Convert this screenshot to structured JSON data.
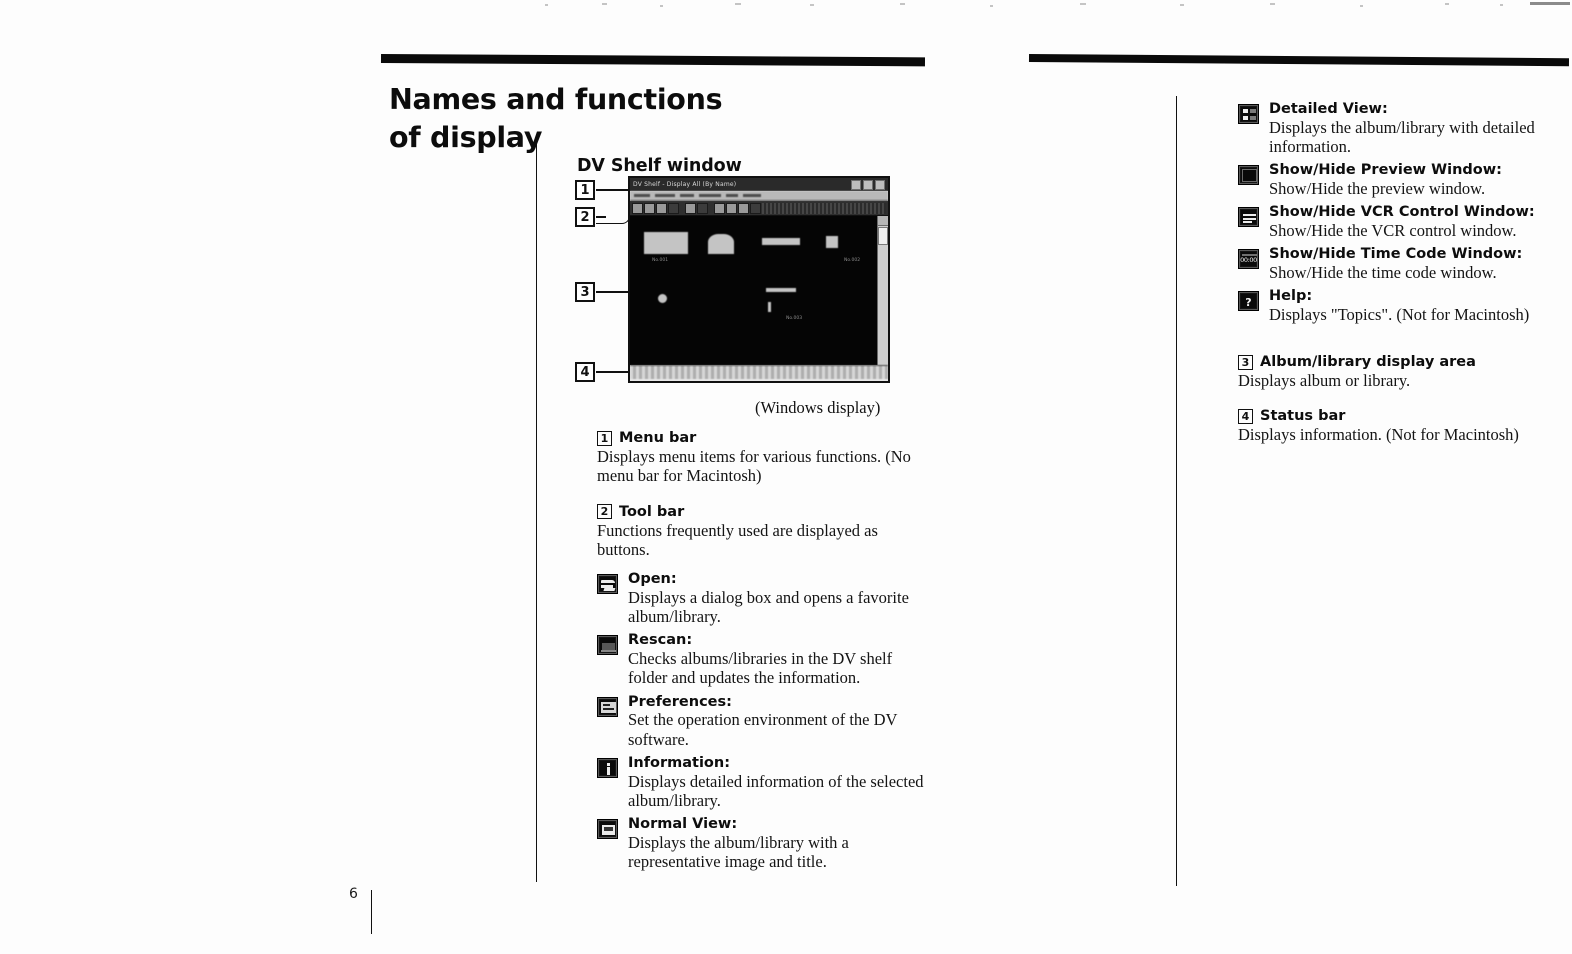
{
  "document": {
    "headline_line1": "Names and functions",
    "headline_line2": "of display",
    "section_heading": "DV Shelf window",
    "figure_caption": "(Windows display)",
    "page_number": "6"
  },
  "figure": {
    "callouts": [
      "1",
      "2",
      "3",
      "4"
    ],
    "window": {
      "title": "DV Shelf - Display All (By Name)",
      "thumb_labels": [
        "No.001",
        "No.002",
        "No.003"
      ]
    }
  },
  "left_column": {
    "items": [
      {
        "number": "1",
        "label": "Menu bar",
        "description": "Displays menu items for various functions. (No menu bar for Macintosh)"
      },
      {
        "number": "2",
        "label": "Tool bar",
        "description": "Functions frequently used are displayed as buttons."
      }
    ],
    "tools": [
      {
        "icon": "open-icon",
        "term": "Open:",
        "description": "Displays a dialog box and opens a favorite album/library."
      },
      {
        "icon": "rescan-icon",
        "term": "Rescan:",
        "description": "Checks albums/libraries in the DV shelf folder and updates the information."
      },
      {
        "icon": "preferences-icon",
        "term": "Preferences:",
        "description": "Set the operation environment of the DV software."
      },
      {
        "icon": "information-icon",
        "term": "Information:",
        "description": "Displays detailed information of the selected album/library."
      },
      {
        "icon": "normal-view-icon",
        "term": "Normal View:",
        "description": "Displays the album/library with a representative image and title."
      }
    ]
  },
  "right_column": {
    "tools": [
      {
        "icon": "detailed-view-icon",
        "term": "Detailed View:",
        "description": "Displays the album/library with detailed information."
      },
      {
        "icon": "show-hide-preview-window-icon",
        "term": "Show/Hide Preview Window:",
        "description": "Show/Hide the preview window."
      },
      {
        "icon": "show-hide-vcr-control-window-icon",
        "term": "Show/Hide VCR Control Window:",
        "description": "Show/Hide the VCR control window."
      },
      {
        "icon": "show-hide-time-code-window-icon",
        "term": "Show/Hide Time Code Window:",
        "description": "Show/Hide the time code window."
      },
      {
        "icon": "help-icon",
        "term": "Help:",
        "description": "Displays \"Topics\". (Not for Macintosh)"
      }
    ],
    "items": [
      {
        "number": "3",
        "label": "Album/library display area",
        "description": "Displays album or library."
      },
      {
        "number": "4",
        "label": "Status bar",
        "description": "Displays information. (Not for Macintosh)"
      }
    ],
    "time_code_glyph": "00:00",
    "help_glyph": "?"
  }
}
